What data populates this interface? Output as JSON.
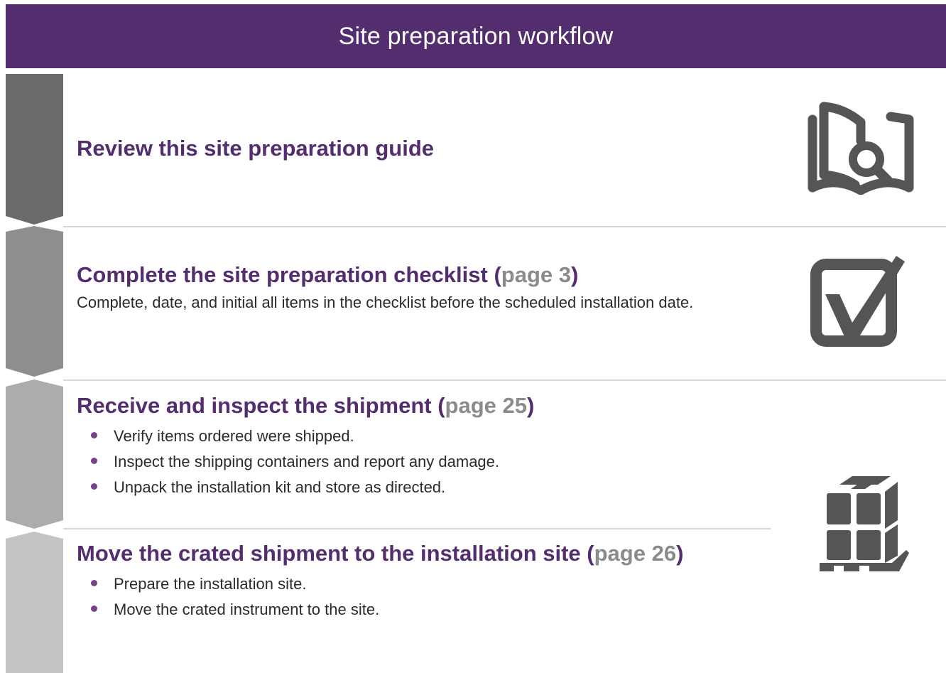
{
  "header": {
    "title": "Site preparation workflow"
  },
  "colors": {
    "header_bg": "#532d6d",
    "title_text": "#532d6d",
    "page_ref": "#8b8b8b",
    "chevron_1": "#6b6b6b",
    "chevron_2": "#8e8e8e",
    "chevron_3": "#acacac",
    "chevron_4": "#c4c4c4",
    "icon": "#555555"
  },
  "steps": [
    {
      "title": "Review this site preparation guide",
      "icon": "book-magnifier-icon"
    },
    {
      "title": "Complete the site preparation checklist",
      "open": "(",
      "page_ref": "page 3",
      "close": ")",
      "description": "Complete, date, and initial all items in the checklist before the scheduled installation date.",
      "icon": "checkbox-checked-icon"
    },
    {
      "title": "Receive and inspect the shipment",
      "open": "(",
      "page_ref": "page 25",
      "close": ")",
      "bullets": [
        "Verify items ordered were shipped.",
        "Inspect the shipping containers and report any damage.",
        "Unpack the installation kit and store as directed."
      ],
      "icon": "crated-pallet-icon"
    },
    {
      "title": "Move the crated shipment to the installation site",
      "open": "(",
      "page_ref": "page 26",
      "close": ")",
      "bullets": [
        "Prepare the installation site.",
        "Move the crated instrument to the site."
      ]
    }
  ]
}
